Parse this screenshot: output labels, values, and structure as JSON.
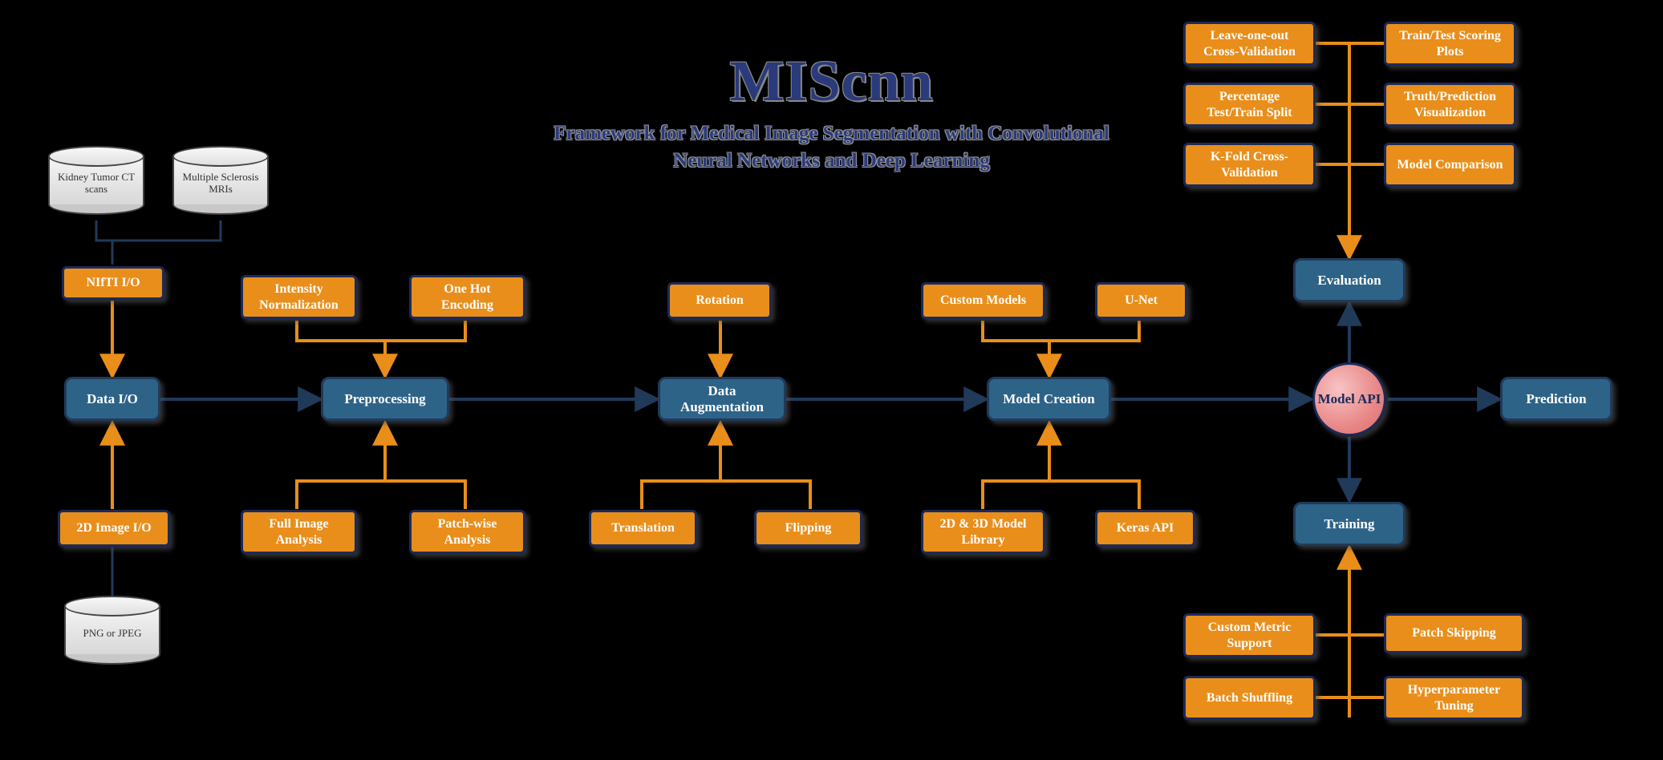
{
  "title": "MIScnn",
  "subtitle": "Framework for Medical Image Segmentation with Convolutional Neural Networks and Deep Learning",
  "cylinders": {
    "kidney": "Kidney Tumor CT scans",
    "ms": "Multiple Sclerosis MRIs",
    "png": "PNG or JPEG"
  },
  "pipeline": {
    "data_io": "Data I/O",
    "preprocessing": "Preprocessing",
    "data_aug": "Data Augmentation",
    "model_creation": "Model Creation",
    "model_api": "Model API",
    "evaluation": "Evaluation",
    "training": "Training",
    "prediction": "Prediction"
  },
  "options": {
    "nifti": "NIfTI I/O",
    "2d_image_io": "2D Image I/O",
    "intensity_norm": "Intensity Normalization",
    "one_hot": "One Hot Encoding",
    "full_image": "Full Image Analysis",
    "patch_wise": "Patch-wise Analysis",
    "rotation": "Rotation",
    "translation": "Translation",
    "flipping": "Flipping",
    "custom_models": "Custom Models",
    "unet": "U-Net",
    "2d3d_lib": "2D & 3D Model Library",
    "keras_api": "Keras API",
    "loo_cv": "Leave-one-out Cross-Validation",
    "traintest_plots": "Train/Test Scoring Plots",
    "pct_split": "Percentage Test/Train Split",
    "truth_pred": "Truth/Prediction Visualization",
    "kfold": "K-Fold Cross-Validation",
    "model_comp": "Model Comparison",
    "custom_metric": "Custom Metric Support",
    "patch_skip": "Patch Skipping",
    "batch_shuffle": "Batch Shuffling",
    "hyper_tune": "Hyperparameter Tuning"
  }
}
